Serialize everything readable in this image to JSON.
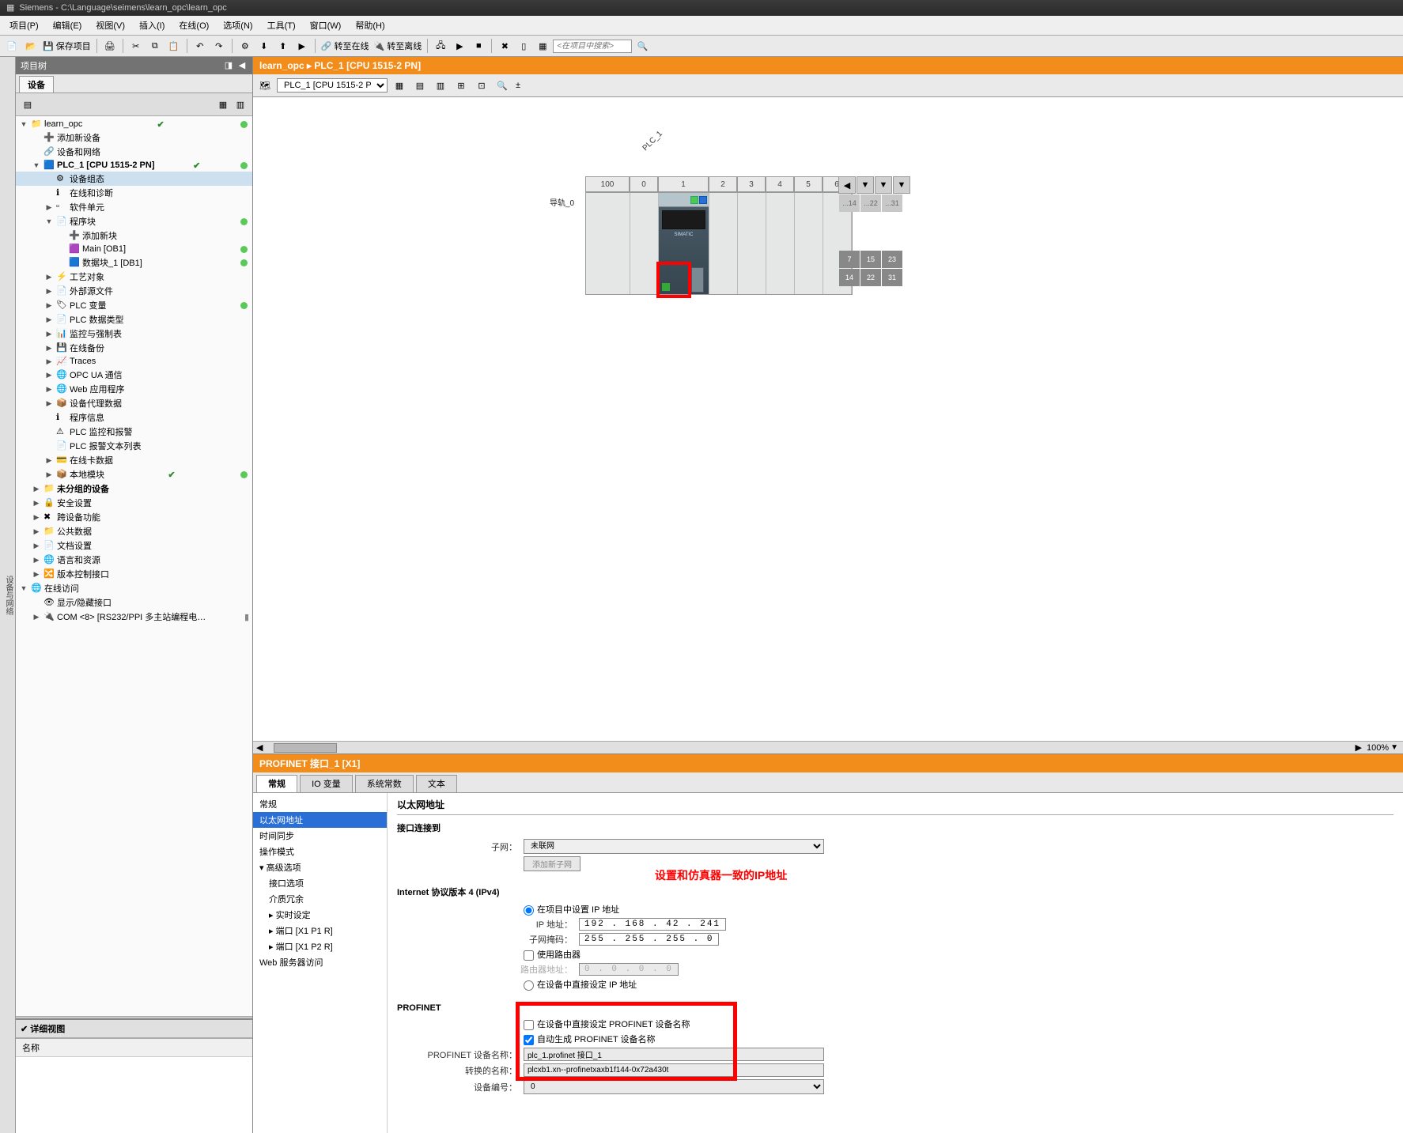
{
  "titlebar": "Siemens  -  C:\\Language\\seimens\\learn_opc\\learn_opc",
  "menu": [
    "项目(P)",
    "编辑(E)",
    "视图(V)",
    "插入(I)",
    "在线(O)",
    "选项(N)",
    "工具(T)",
    "窗口(W)",
    "帮助(H)"
  ],
  "toolbar": {
    "save": "保存项目",
    "go_online": "转至在线",
    "go_offline": "转至离线",
    "search_ph": "<在项目中搜索>"
  },
  "sidebar": {
    "title": "项目树",
    "tab": "设备",
    "vtab": "设备与网络"
  },
  "tree": {
    "root": "learn_opc",
    "add_dev": "添加新设备",
    "dev_net": "设备和网络",
    "plc": "PLC_1 [CPU 1515-2 PN]",
    "dev_cfg": "设备组态",
    "online_diag": "在线和诊断",
    "sw_unit": "软件单元",
    "prog_blocks": "程序块",
    "add_block": "添加新块",
    "main": "Main [OB1]",
    "db": "数据块_1 [DB1]",
    "tech": "工艺对象",
    "ext_src": "外部源文件",
    "tags": "PLC 变量",
    "types": "PLC 数据类型",
    "watch": "监控与强制表",
    "backup": "在线备份",
    "traces": "Traces",
    "opcua": "OPC UA 通信",
    "web": "Web 应用程序",
    "proxy": "设备代理数据",
    "proginfo": "程序信息",
    "alarm": "PLC 监控和报警",
    "alarmtxt": "PLC 报警文本列表",
    "online_card": "在线卡数据",
    "localmod": "本地模块",
    "ungrouped": "未分组的设备",
    "security": "安全设置",
    "crossdev": "跨设备功能",
    "common": "公共数据",
    "docset": "文档设置",
    "lang": "语言和资源",
    "ver": "版本控制接口",
    "online_access": "在线访问",
    "hideif": "显示/隐藏接口",
    "com": "COM <8> [RS232/PPI 多主站编程电…"
  },
  "detail": {
    "title": "详细视图",
    "col": "名称"
  },
  "breadcrumb": "learn_opc  ▸  PLC_1 [CPU 1515-2 PN]",
  "dev": {
    "dropdown": "PLC_1 [CPU 1515-2 PN]",
    "rail": "导轨_0",
    "plc": "PLC_1",
    "zoom": "100%"
  },
  "slots": {
    "hdr": [
      "100",
      "0",
      "1",
      "2",
      "3",
      "4",
      "5",
      "6"
    ],
    "ext_top": [
      "...14",
      "...22",
      "...31"
    ],
    "ext_mid": [
      "7",
      "15",
      "23"
    ],
    "ext_bot": [
      "14",
      "22",
      "31"
    ]
  },
  "prop": {
    "title": "PROFINET 接口_1 [X1]",
    "tabs": [
      "常规",
      "IO 变量",
      "系统常数",
      "文本"
    ],
    "nav": {
      "general": "常规",
      "eth": "以太网地址",
      "time": "时间同步",
      "opmode": "操作模式",
      "adv": "高级选项",
      "ifopt": "接口选项",
      "media": "介质冗余",
      "rt": "实时设定",
      "p1": "端口 [X1 P1 R]",
      "p2": "端口 [X1 P2 R]",
      "webacc": "Web 服务器访问"
    },
    "eth": {
      "header": "以太网地址",
      "connect": "接口连接到",
      "subnet_lbl": "子网：",
      "subnet_val": "未联网",
      "add_subnet": "添加新子网",
      "ipv4": "Internet 协议版本 4 (IPv4)",
      "opt_setinproj": "在项目中设置 IP 地址",
      "ip_lbl": "IP 地址：",
      "ip": "192 . 168 .  42  . 241",
      "mask_lbl": "子网掩码：",
      "mask": "255 . 255 . 255 .  0",
      "userouter": "使用路由器",
      "router_lbl": "路由器地址：",
      "router": "0   .  0   .  0   .  0",
      "opt_setondev": "在设备中直接设定 IP 地址",
      "profinet": "PROFINET",
      "opt_pn_ondev": "在设备中直接设定 PROFINET 设备名称",
      "opt_pn_auto": "自动生成 PROFINET 设备名称",
      "pn_name_lbl": "PROFINET 设备名称：",
      "pn_name": "plc_1.profinet 接口_1",
      "conv_lbl": "转换的名称：",
      "conv": "plcxb1.xn--profinetxaxb1f144-0x72a430t",
      "devno_lbl": "设备编号：",
      "devno": "0"
    },
    "annotation": "设置和仿真器一致的IP地址"
  }
}
